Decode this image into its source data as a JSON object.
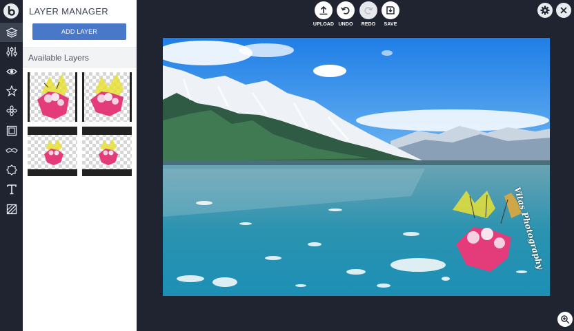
{
  "panel": {
    "title": "LAYER MANAGER",
    "add_layer_label": "ADD LAYER",
    "available_layers_label": "Available Layers"
  },
  "toolbar": {
    "upload_label": "UPLOAD",
    "undo_label": "UNDO",
    "redo_label": "REDO",
    "save_label": "SAVE"
  },
  "rail": {
    "items": [
      "layers-icon",
      "sliders-icon",
      "eye-icon",
      "star-icon",
      "flower-icon",
      "frame-icon",
      "mustache-icon",
      "badge-icon",
      "text-icon",
      "overlay-icon"
    ],
    "active": "layers-icon"
  },
  "canvas": {
    "watermark_text": "Vitas Photography"
  },
  "layers": [
    {
      "name": "flower-layer-1"
    },
    {
      "name": "flower-layer-2"
    },
    {
      "name": "flower-layer-3"
    },
    {
      "name": "flower-layer-4"
    }
  ],
  "colors": {
    "background": "#1f2430",
    "accent": "#4a78c8",
    "panel": "#ffffff"
  }
}
